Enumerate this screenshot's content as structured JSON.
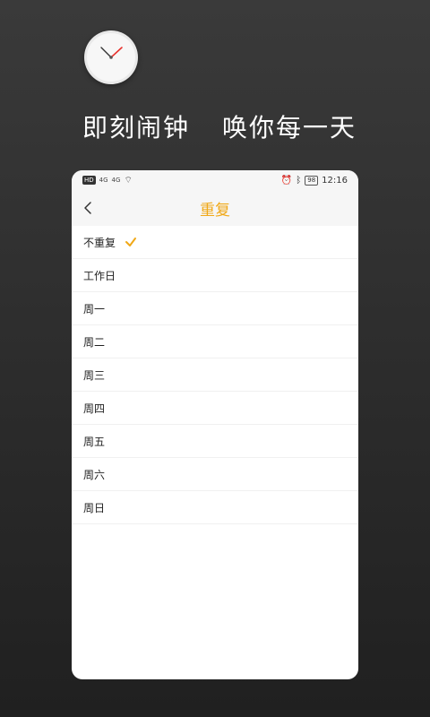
{
  "promo": {
    "tagline_part1": "即刻闹钟",
    "tagline_part2": "唤你每一天"
  },
  "status_bar": {
    "left_badge": "HD",
    "signal1": "4G",
    "signal2": "4G",
    "right_battery": "98",
    "time": "12:16"
  },
  "screen": {
    "title": "重复",
    "selected_index": 0,
    "options": [
      {
        "label": "不重复"
      },
      {
        "label": "工作日"
      },
      {
        "label": "周一"
      },
      {
        "label": "周二"
      },
      {
        "label": "周三"
      },
      {
        "label": "周四"
      },
      {
        "label": "周五"
      },
      {
        "label": "周六"
      },
      {
        "label": "周日"
      }
    ]
  },
  "colors": {
    "accent": "#f0a817"
  }
}
